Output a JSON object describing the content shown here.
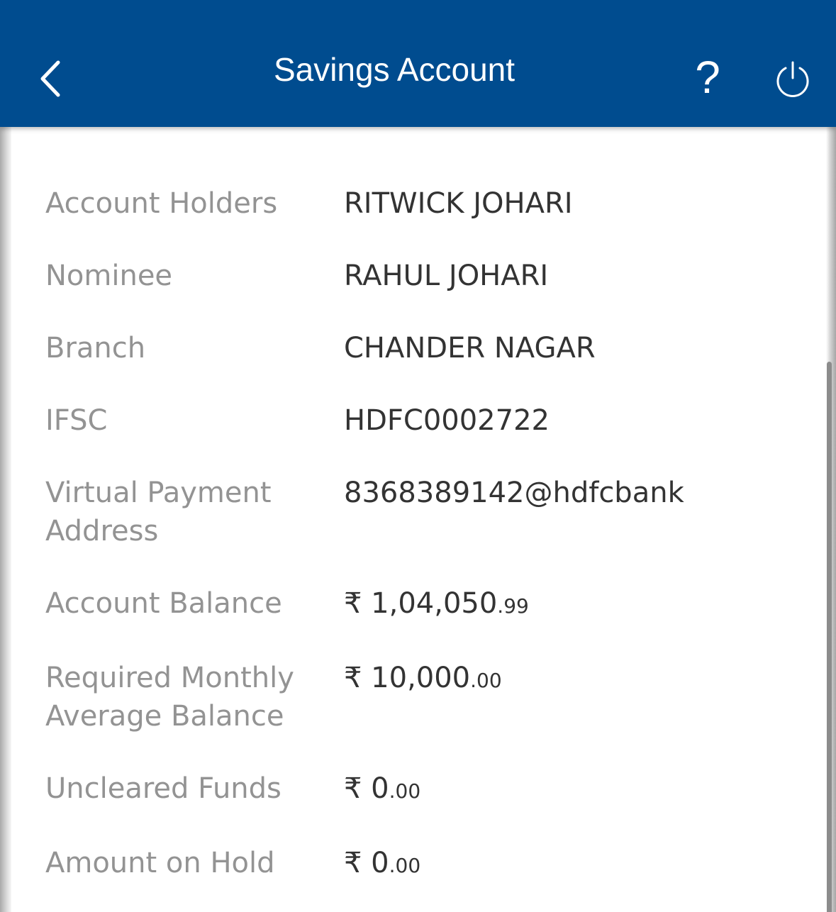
{
  "header": {
    "title": "Savings Account",
    "back_icon": "chevron-left-icon",
    "help_label": "?",
    "power_icon": "power-icon",
    "background_color": "#004c8f"
  },
  "details": {
    "account_holders": {
      "label": "Account Holders",
      "value": "RITWICK JOHARI"
    },
    "nominee": {
      "label": "Nominee",
      "value": "RAHUL JOHARI"
    },
    "branch": {
      "label": "Branch",
      "value": "CHANDER NAGAR"
    },
    "ifsc": {
      "label": "IFSC",
      "value": "HDFC0002722"
    },
    "vpa": {
      "label_line1": "Virtual Payment",
      "label_line2": "Address",
      "value": "8368389142@hdfcbank"
    },
    "account_balance": {
      "label": "Account Balance",
      "currency": "₹",
      "main": "1,04,050",
      "cents": ".99"
    },
    "required_mab": {
      "label_line1": "Required Monthly",
      "label_line2": "Average Balance",
      "currency": "₹",
      "main": "10,000",
      "cents": ".00"
    },
    "uncleared_funds": {
      "label": "Uncleared Funds",
      "currency": "₹",
      "main": "0",
      "cents": ".00"
    },
    "amount_on_hold": {
      "label": "Amount on Hold",
      "currency": "₹",
      "main": "0",
      "cents": ".00"
    }
  }
}
